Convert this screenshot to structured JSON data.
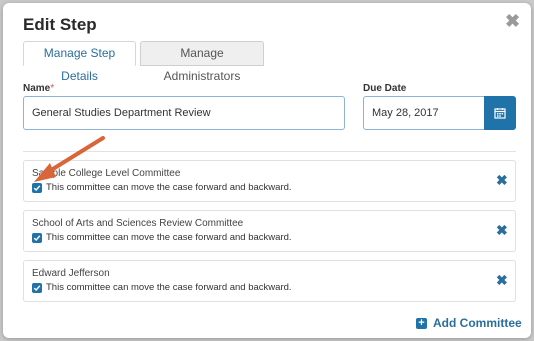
{
  "dialog": {
    "title": "Edit Step",
    "close_icon": "close-icon"
  },
  "tabs": [
    {
      "label": "Manage Step Details",
      "active": true
    },
    {
      "label": "Manage Administrators",
      "active": false
    }
  ],
  "form": {
    "name_label": "Name",
    "required_marker": "*",
    "name_value": "General Studies Department Review",
    "due_date_label": "Due Date",
    "due_date_value": "May 28, 2017",
    "calendar_icon": "calendar-icon"
  },
  "committees": [
    {
      "name": "Sample College Level Committee",
      "checkbox_label": "This committee can move the case forward and backward.",
      "checked": true
    },
    {
      "name": "School of Arts and Sciences Review Committee",
      "checkbox_label": "This committee can move the case forward and backward.",
      "checked": true
    },
    {
      "name": "Edward Jefferson",
      "checkbox_label": "This committee can move the case forward and backward.",
      "checked": true
    }
  ],
  "add_committee": {
    "label": "Add Committee",
    "icon": "plus-square-icon"
  },
  "colors": {
    "accent": "#1f73a8",
    "link": "#2a6f9b",
    "annotation_arrow": "#d9663a"
  }
}
